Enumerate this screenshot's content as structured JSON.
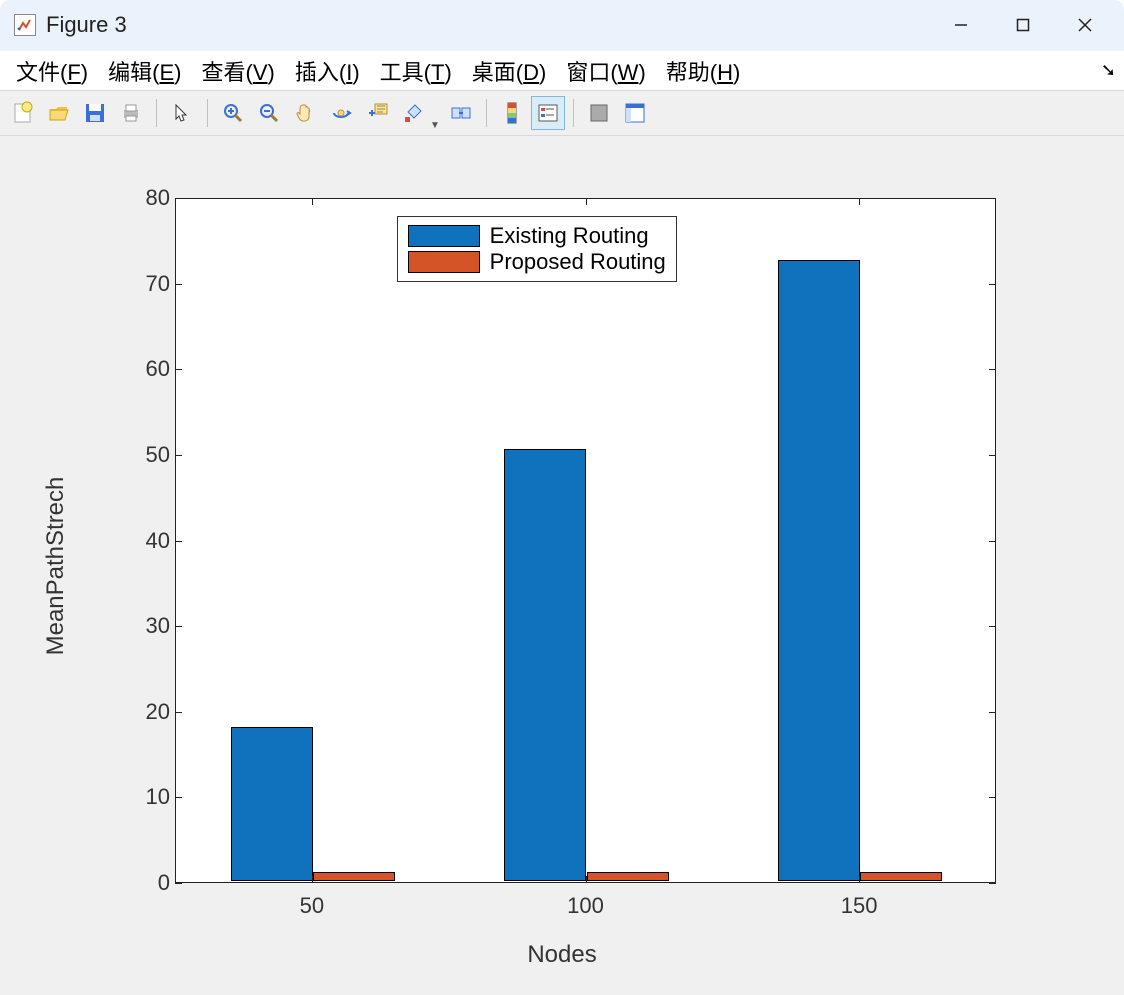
{
  "window": {
    "title": "Figure 3"
  },
  "menu": {
    "file": {
      "label": "文件",
      "accel": "F"
    },
    "edit": {
      "label": "编辑",
      "accel": "E"
    },
    "view": {
      "label": "查看",
      "accel": "V"
    },
    "insert": {
      "label": "插入",
      "accel": "I"
    },
    "tools": {
      "label": "工具",
      "accel": "T"
    },
    "desktop": {
      "label": "桌面",
      "accel": "D"
    },
    "window": {
      "label": "窗口",
      "accel": "W"
    },
    "help": {
      "label": "帮助",
      "accel": "H"
    }
  },
  "toolbar": {
    "new": "new-figure-icon",
    "open": "open-icon",
    "save": "save-icon",
    "print": "print-icon",
    "pointer": "pointer-icon",
    "zoom_in": "zoom-in-icon",
    "zoom_out": "zoom-out-icon",
    "pan": "pan-icon",
    "rotate": "rotate-3d-icon",
    "data_cursor": "data-cursor-icon",
    "brush": "brush-icon",
    "link": "link-plots-icon",
    "colorbar": "colorbar-icon",
    "legend": "legend-icon",
    "hide": "hide-plot-tools-icon",
    "layout": "layout-icon"
  },
  "chart_data": {
    "type": "bar",
    "categories": [
      "50",
      "100",
      "150"
    ],
    "series": [
      {
        "name": "Existing Routing",
        "color": "#1072bd",
        "values": [
          18,
          50.5,
          72.5
        ]
      },
      {
        "name": "Proposed Routing",
        "color": "#d55427",
        "values": [
          1,
          1,
          1
        ]
      }
    ],
    "xlabel": "Nodes",
    "ylabel": "MeanPathStrech",
    "ylim": [
      0,
      80
    ],
    "yticks": [
      0,
      10,
      20,
      30,
      40,
      50,
      60,
      70,
      80
    ],
    "xticks": [
      "50",
      "100",
      "150"
    ],
    "legend_position": "top-center"
  }
}
